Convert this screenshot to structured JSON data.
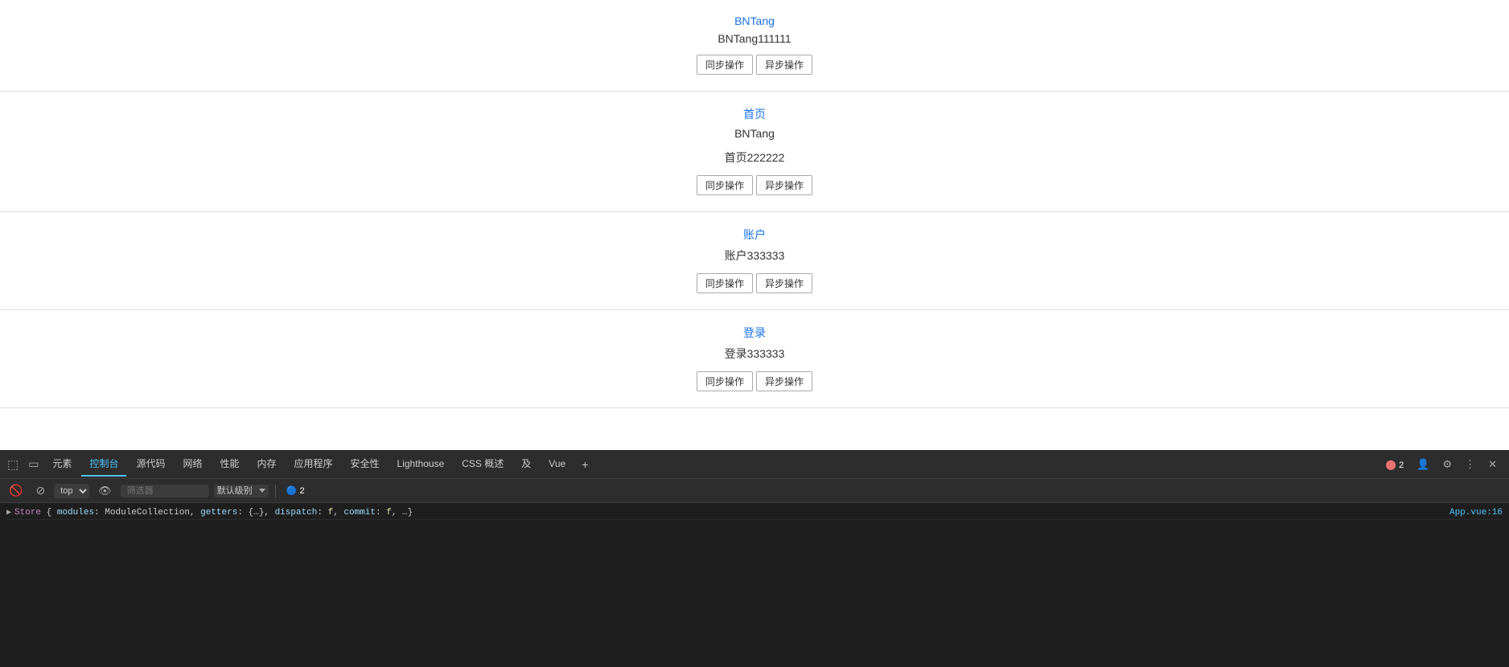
{
  "main": {
    "sections": [
      {
        "id": "bntang",
        "title": "BNTang",
        "subtitle": "BNTang111111",
        "sync_btn": "同步操作",
        "async_btn": "异步操作"
      },
      {
        "id": "homepage",
        "title": "首页",
        "subtitle_line1": "BNTang",
        "subtitle_line2": "首页222222",
        "sync_btn": "同步操作",
        "async_btn": "异步操作"
      },
      {
        "id": "account",
        "title": "账户",
        "subtitle": "账户333333",
        "sync_btn": "同步操作",
        "async_btn": "异步操作"
      },
      {
        "id": "login",
        "title": "登录",
        "subtitle": "登录333333",
        "sync_btn": "同步操作",
        "async_btn": "异步操作"
      }
    ]
  },
  "devtools": {
    "tabs": [
      {
        "label": "元素",
        "active": false
      },
      {
        "label": "控制台",
        "active": true
      },
      {
        "label": "源代码",
        "active": false
      },
      {
        "label": "网络",
        "active": false
      },
      {
        "label": "性能",
        "active": false
      },
      {
        "label": "内存",
        "active": false
      },
      {
        "label": "应用程序",
        "active": false
      },
      {
        "label": "安全性",
        "active": false
      },
      {
        "label": "Lighthouse",
        "active": false
      },
      {
        "label": "CSS 概述",
        "active": false
      },
      {
        "label": "及",
        "active": false
      },
      {
        "label": "Vue",
        "active": false
      }
    ],
    "toolbar": {
      "top_label": "top",
      "filter_placeholder": "筛选器",
      "level_label": "默认级别",
      "badge_count": "2"
    },
    "console": {
      "row1_text": "▶ Store {modules: ModuleCollection, getters: {…}, dispatch: f, commit: f, …}",
      "row1_link": "App.vue:16"
    },
    "icon_badges": {
      "errors": "2"
    }
  }
}
